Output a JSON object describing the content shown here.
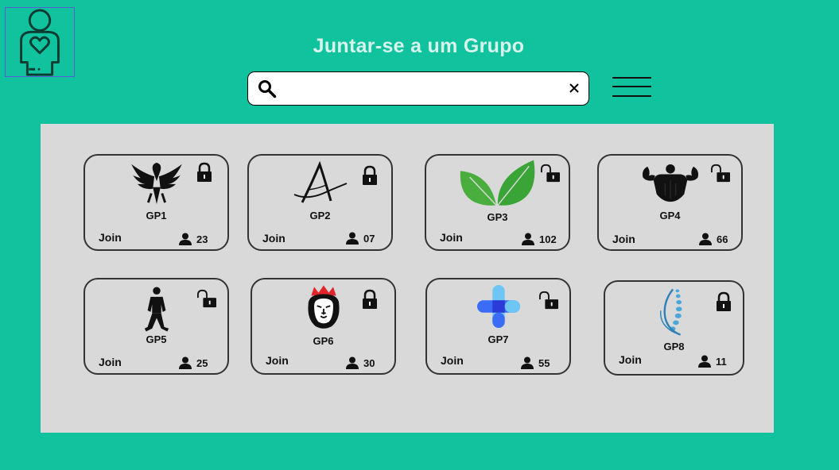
{
  "header": {
    "title": "Juntar-se a um Grupo",
    "search": {
      "value": "",
      "placeholder": ""
    }
  },
  "colors": {
    "background": "#10c29e",
    "panel": "#d9d9d9",
    "title": "#d6f3ec"
  },
  "groups": [
    {
      "name": "GP1",
      "join_label": "Join",
      "members": "23",
      "lock": "locked",
      "icon": "eagle-icon"
    },
    {
      "name": "GP2",
      "join_label": "Join",
      "members": "07",
      "lock": "locked",
      "icon": "letter-a-icon"
    },
    {
      "name": "GP3",
      "join_label": "Join",
      "members": "102",
      "lock": "unlocked",
      "icon": "leaves-icon"
    },
    {
      "name": "GP4",
      "join_label": "Join",
      "members": "66",
      "lock": "unlocked",
      "icon": "bodybuilder-icon"
    },
    {
      "name": "GP5",
      "join_label": "Join",
      "members": "25",
      "lock": "unlocked",
      "icon": "soccer-player-icon"
    },
    {
      "name": "GP6",
      "join_label": "Join",
      "members": "30",
      "lock": "locked",
      "icon": "lion-icon"
    },
    {
      "name": "GP7",
      "join_label": "Join",
      "members": "55",
      "lock": "unlocked",
      "icon": "medical-cross-icon"
    },
    {
      "name": "GP8",
      "join_label": "Join",
      "members": "11",
      "lock": "locked",
      "icon": "spine-icon"
    }
  ]
}
